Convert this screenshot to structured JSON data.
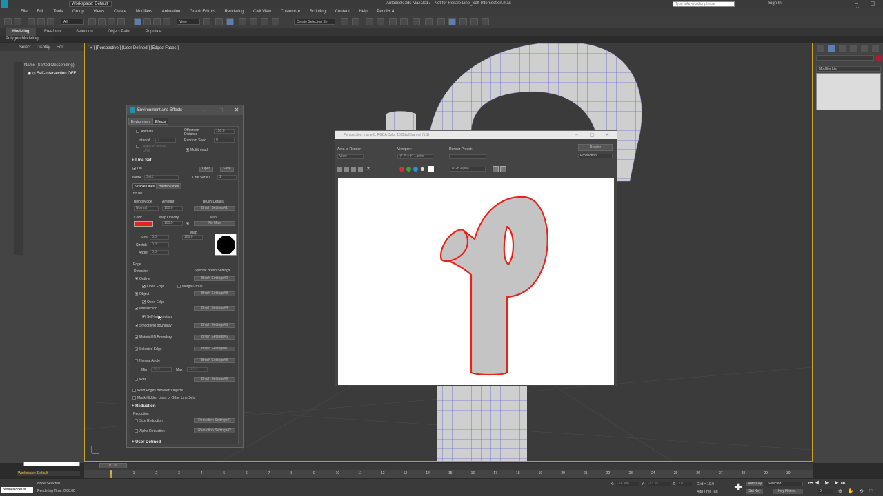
{
  "title_bar": {
    "workspace": "Workspace: Default",
    "title": "Autodesk 3ds Max 2017 - Not for Resale   Line_Self-Intersection.max",
    "search_placeholder": "Type a keyword or phrase",
    "sign_in": "Sign In"
  },
  "menu": [
    "File",
    "Edit",
    "Tools",
    "Group",
    "Views",
    "Create",
    "Modifiers",
    "Animation",
    "Graph Editors",
    "Rendering",
    "Civil View",
    "Customize",
    "Scripting",
    "Content",
    "Help",
    "Pencil+ 4"
  ],
  "toolbar": {
    "selection_filter": "All",
    "ref_coord": "View",
    "named_selection": "Create Selection Se"
  },
  "ribbon": {
    "tabs": [
      "Modeling",
      "Freeform",
      "Selection",
      "Object Paint",
      "Populate"
    ],
    "subtitle": "Polygon Modeling"
  },
  "scene_explorer": {
    "tabs": [
      "Select",
      "Display",
      "Edit"
    ],
    "header": "Name (Sorted Descending)",
    "item": "Self-Intersection OFF"
  },
  "viewport": {
    "label": "[ + ] [Perspective ] [User Defined ] [Edged Faces ]"
  },
  "command_panel": {
    "modifier_list": "Modifier List"
  },
  "env_dialog": {
    "title": "Environment and Effects",
    "tabs": [
      "Environment",
      "Effects"
    ],
    "animate": "Animate",
    "offscreen_distance": "Offscreen Distance",
    "offscreen_value": "150.0",
    "interval": "Interval",
    "interval_value": "1",
    "random_seed": "Random Seed",
    "random_seed_value": "0",
    "apply_in_motion": "Apply in Motion Only",
    "multithread": "Multithread",
    "line_set_header": "Line Set",
    "on": "On",
    "open": "Open",
    "save": "Save",
    "name_label": "Name",
    "name_value": "Set1",
    "line_set_id": "Line Set ID",
    "line_set_id_value": "1",
    "line_tabs": [
      "Visible Lines",
      "Hidden Lines"
    ],
    "brush": "Brush",
    "blend_mode": "Blend Mode",
    "blend_mode_value": "Normal",
    "amount": "Amount",
    "amount_value": "100.0",
    "brush_details": "Brush Details",
    "brush_settings_1": "Brush Settings#1",
    "color": "Color",
    "map_opacity": "Map Opacity",
    "map_opacity_value": "100.0",
    "map": "Map",
    "no_map": "No Map",
    "size": "Size",
    "size_value": "3.0",
    "map_label": "Map",
    "map_value": "100.0",
    "stretch": "Stretch",
    "stretch_value": "0.0",
    "angle": "Angle",
    "angle_value": "0.0",
    "edge": "Edge",
    "detection": "Detection",
    "specific_brush": "Specific Brush Settings",
    "edge_rows": [
      {
        "label": "Outline",
        "btn": "Brush Settings#2"
      },
      {
        "label": "Object",
        "btn": "Brush Settings#3"
      },
      {
        "label": "Intersection",
        "btn": "Brush Settings#4"
      },
      {
        "label": "Smoothing Boundary",
        "btn": "Brush Settings#5"
      },
      {
        "label": "Material ID Boundary",
        "btn": "Brush Settings#6"
      },
      {
        "label": "Selected Edge",
        "btn": "Brush Settings#7"
      },
      {
        "label": "Normal Angle",
        "btn": "Brush Settings#8"
      },
      {
        "label": "Wire",
        "btn": "Brush Settings#9"
      }
    ],
    "open_edge": "Open Edge",
    "merge_group": "Merge Group",
    "open_edge2": "Open Edge",
    "self_intersection": "Self-Intersection",
    "min": "Min",
    "min_value": "45.0",
    "max": "Max",
    "max_value": "180.0",
    "weld_edges": "Weld Edges Between Objects",
    "mask_hidden": "Mask Hidden Lines of Other Line Sets",
    "reduction_header": "Reduction",
    "reduction": "Reduction",
    "size_reduction": "Size Reduction",
    "reduction_settings_1": "Reduction Settings#1",
    "alpha_reduction": "Alpha Reduction",
    "reduction_settings_2": "Reduction Settings#2",
    "user_defined": "User Defined",
    "brush_color": "#e8231b"
  },
  "frame_buffer": {
    "title": "Perspective, frame 0, RGBA Color 16 Bits/Channel (1:1)",
    "area_to_render": "Area to Render:",
    "area_value": "View",
    "viewport": "Viewport:",
    "viewport_value": "クアッド ...ctive",
    "render_preset": "Render Preset:",
    "render": "Render",
    "production": "Production",
    "channel": "RGB Alpha",
    "line_color": "#e8231b",
    "fill_color": "#c4c4c4"
  },
  "timeline": {
    "frame": "0 / 30",
    "ticks": [
      "0",
      "1",
      "2",
      "3",
      "4",
      "5",
      "6",
      "7",
      "8",
      "9",
      "10",
      "11",
      "12",
      "13",
      "14",
      "15",
      "16",
      "17",
      "18",
      "19",
      "20",
      "21",
      "22",
      "23",
      "24",
      "25",
      "26",
      "27",
      "28",
      "29",
      "30"
    ]
  },
  "status": {
    "workspace": "Workspace: Default",
    "none_selected": "None Selected",
    "rendering_time": "Rendering Time: 0:00:00",
    "script": "outlineNodeLis",
    "x_label": "X:",
    "x_value": "-24.908",
    "y_label": "Y:",
    "y_value": "-51.551",
    "z_label": "Z:",
    "z_value": "0.0",
    "grid": "Grid = 10.0",
    "add_time_tag": "Add Time Tag",
    "auto_key": "Auto Key",
    "set_key": "Set Key",
    "selected": "Selected",
    "key_filters": "Key Filters...",
    "frame_field": "0"
  }
}
